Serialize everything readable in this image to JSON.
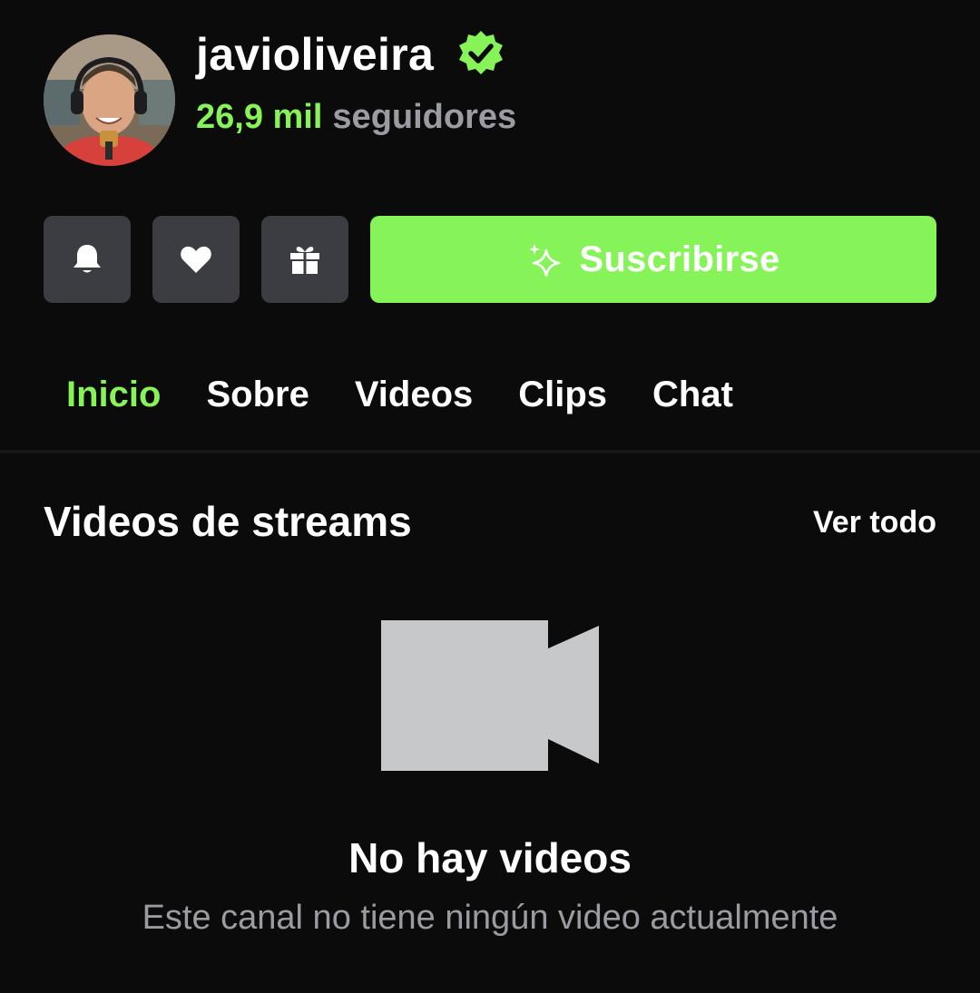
{
  "profile": {
    "username": "javioliveira",
    "followers_count": "26,9 mil",
    "followers_label": "seguidores",
    "verified": true,
    "avatar_icon": "avatar-photo"
  },
  "actions": {
    "notifications_icon": "bell-icon",
    "follow_icon": "heart-icon",
    "gift_icon": "gift-icon",
    "subscribe_label": "Suscribirse",
    "subscribe_icon": "sparkle-icon"
  },
  "tabs": [
    {
      "label": "Inicio",
      "active": true
    },
    {
      "label": "Sobre",
      "active": false
    },
    {
      "label": "Videos",
      "active": false
    },
    {
      "label": "Clips",
      "active": false
    },
    {
      "label": "Chat",
      "active": false
    }
  ],
  "section": {
    "title": "Videos de streams",
    "see_all": "Ver todo"
  },
  "empty_state": {
    "icon": "video-camera-icon",
    "title": "No hay videos",
    "subtitle": "Este canal no tiene ningún video actualmente"
  },
  "colors": {
    "accent": "#86f359",
    "background": "#0b0b0c",
    "button_bg": "#3b3d42",
    "muted_text": "#9a9ca1"
  }
}
